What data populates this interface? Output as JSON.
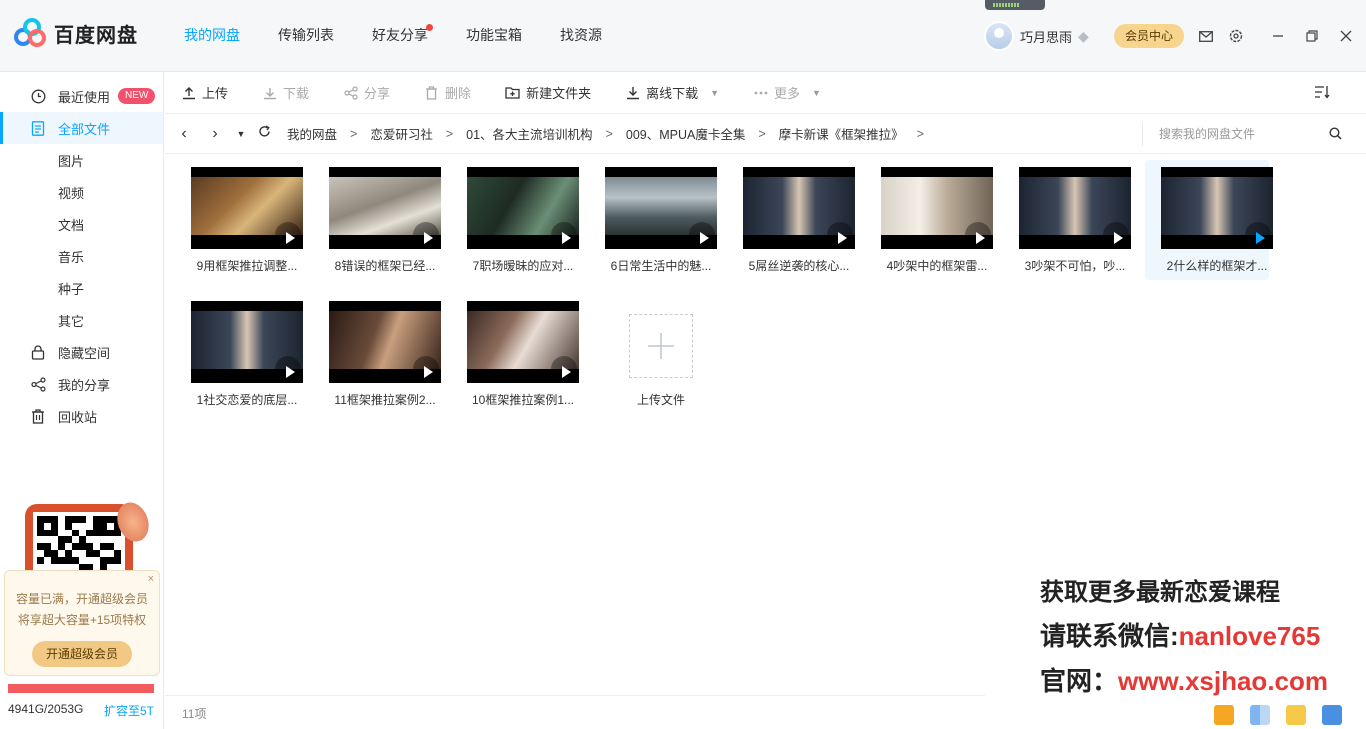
{
  "app": {
    "name": "百度网盘",
    "brand_colors": [
      "#06a7ff",
      "#f04646",
      "#f1c985"
    ]
  },
  "nav": {
    "tabs": [
      {
        "label": "我的网盘",
        "active": true
      },
      {
        "label": "传输列表",
        "active": false
      },
      {
        "label": "好友分享",
        "active": false,
        "dot": true
      },
      {
        "label": "功能宝箱",
        "active": false
      },
      {
        "label": "找资源",
        "active": false
      }
    ]
  },
  "user": {
    "name": "巧月思雨",
    "member_center": "会员中心"
  },
  "sidebar": {
    "items": [
      {
        "label": "最近使用",
        "icon": "clock-icon",
        "badge": "NEW"
      },
      {
        "label": "全部文件",
        "icon": "document-icon",
        "active": true
      },
      {
        "label": "图片",
        "sub": true
      },
      {
        "label": "视频",
        "sub": true
      },
      {
        "label": "文档",
        "sub": true
      },
      {
        "label": "音乐",
        "sub": true
      },
      {
        "label": "种子",
        "sub": true
      },
      {
        "label": "其它",
        "sub": true
      },
      {
        "label": "隐藏空间",
        "icon": "lock-icon"
      },
      {
        "label": "我的分享",
        "icon": "share-icon"
      },
      {
        "label": "回收站",
        "icon": "trash-icon"
      }
    ],
    "promo": {
      "line1": "容量已满，开通超级会员",
      "line2": "将享超大容量+15项特权",
      "button": "开通超级会员",
      "close": "×"
    },
    "quota": {
      "used_text": "4941G/2053G",
      "expand": "扩容至5T"
    }
  },
  "toolbar": {
    "upload": "上传",
    "download": "下载",
    "share": "分享",
    "delete": "删除",
    "new_folder": "新建文件夹",
    "offline_download": "离线下载",
    "more": "更多"
  },
  "breadcrumb": {
    "items": [
      "我的网盘",
      "恋爱研习社",
      "01、各大主流培训机构",
      "009、MPUA魔卡全集",
      "摩卡新课《框架推拉》"
    ],
    "separator": ">"
  },
  "search": {
    "placeholder": "搜索我的网盘文件"
  },
  "files": [
    {
      "name": "9用框架推拉调整...",
      "scene": "cafe"
    },
    {
      "name": "8错误的框架已经...",
      "scene": "bed"
    },
    {
      "name": "7职场暧昧的应对...",
      "scene": "desk"
    },
    {
      "name": "6日常生活中的魅...",
      "scene": "window"
    },
    {
      "name": "5屌丝逆袭的核心...",
      "scene": "lecture"
    },
    {
      "name": "4吵架中的框架雷...",
      "scene": "room"
    },
    {
      "name": "3吵架不可怕，吵...",
      "scene": "lecture"
    },
    {
      "name": "2什么样的框架才...",
      "scene": "lecture",
      "selected": true
    },
    {
      "name": "1社交恋爱的底层...",
      "scene": "lecture"
    },
    {
      "name": "11框架推拉案例2...",
      "scene": "dinner"
    },
    {
      "name": "10框架推拉案例1...",
      "scene": "closeup"
    }
  ],
  "upload_tile": {
    "label": "上传文件"
  },
  "footer": {
    "count": "11项"
  },
  "watermark": {
    "line1": "获取更多最新恋爱课程",
    "line2_prefix": "请联系微信:",
    "line2_value": "nanlove765",
    "line3_prefix": "官网：",
    "line3_value": "www.xsjhao.com"
  }
}
